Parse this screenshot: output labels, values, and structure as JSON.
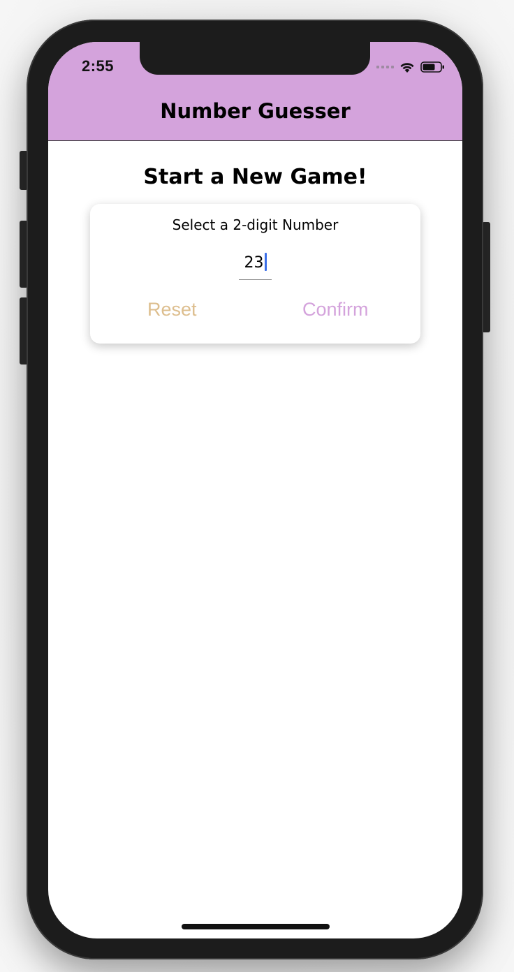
{
  "status_bar": {
    "time": "2:55"
  },
  "header": {
    "title": "Number Guesser",
    "background_color": "#d4a3dc"
  },
  "main": {
    "title": "Start a New Game!",
    "card": {
      "label": "Select a 2-digit Number",
      "input_value": "23",
      "reset_label": "Reset",
      "confirm_label": "Confirm",
      "reset_color": "#ddbe8e",
      "confirm_color": "#d4a3dc"
    }
  },
  "icons": [
    "signal-icon",
    "wifi-icon",
    "battery-icon"
  ]
}
